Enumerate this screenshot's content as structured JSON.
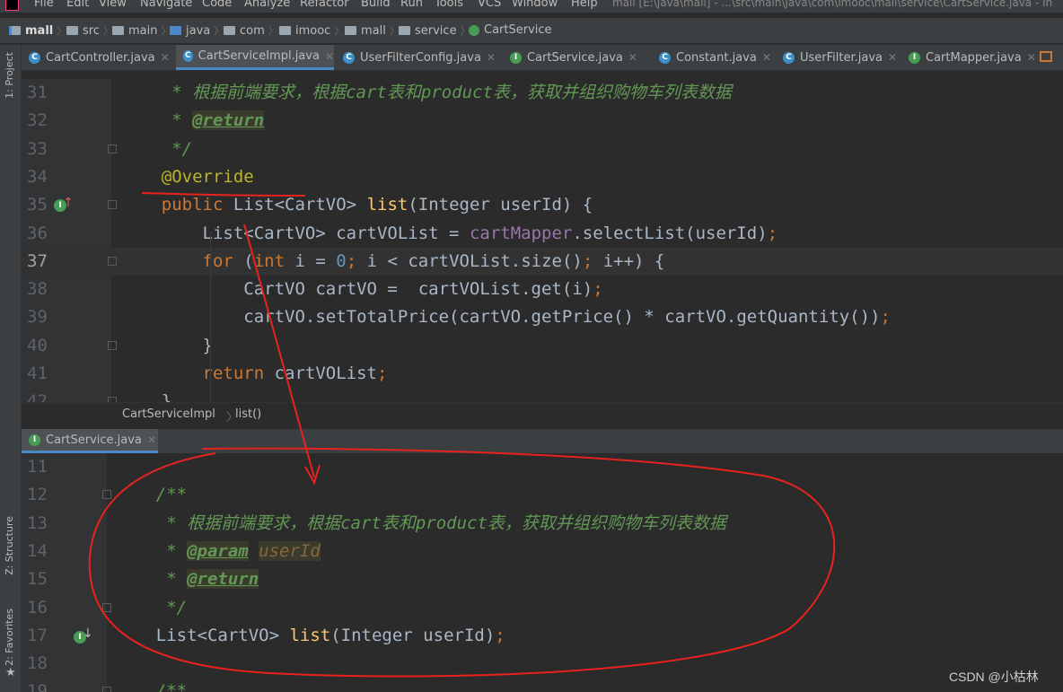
{
  "menu": {
    "items": [
      "File",
      "Edit",
      "View",
      "Navigate",
      "Code",
      "Analyze",
      "Refactor",
      "Build",
      "Run",
      "Tools",
      "VCS",
      "Window",
      "Help"
    ],
    "window_title": "mall [E:\\java\\mall] - ...\\src\\main\\java\\com\\imooc\\mall\\service\\CartService.java - In"
  },
  "navbar": {
    "crumbs": [
      "mall",
      "src",
      "main",
      "java",
      "com",
      "imooc",
      "mall",
      "service",
      "CartService"
    ]
  },
  "tabs": [
    {
      "label": "CartController.java",
      "kind": "class",
      "active": false
    },
    {
      "label": "CartServiceImpl.java",
      "kind": "class",
      "active": true
    },
    {
      "label": "UserFilterConfig.java",
      "kind": "class",
      "active": false
    },
    {
      "label": "CartService.java",
      "kind": "interface",
      "active": false
    },
    {
      "label": "Constant.java",
      "kind": "class",
      "active": false
    },
    {
      "label": "UserFilter.java",
      "kind": "class",
      "active": false
    },
    {
      "label": "CartMapper.java",
      "kind": "interface",
      "active": false
    }
  ],
  "sidebar": {
    "project_label": "1: Project",
    "structure_label": "Z: Structure",
    "favorites_label": "2: Favorites"
  },
  "editor1": {
    "lines": [
      {
        "n": "31",
        "parts": [
          [
            "cm",
            "     * 根据前端要求，根据cart表和product表，获取并组织购物车列表数据"
          ]
        ]
      },
      {
        "n": "32",
        "parts": [
          [
            "cm",
            "     * "
          ],
          [
            "tag",
            "@return"
          ]
        ]
      },
      {
        "n": "33",
        "parts": [
          [
            "cm",
            "     */"
          ]
        ]
      },
      {
        "n": "34",
        "parts": [
          [
            "an",
            "    @Override"
          ]
        ]
      },
      {
        "n": "35",
        "parts": [
          [
            "kw",
            "    public "
          ],
          [
            "",
            "List<CartVO> "
          ],
          [
            "mth",
            "list"
          ],
          [
            "",
            "(Integer userId) {"
          ]
        ]
      },
      {
        "n": "36",
        "parts": [
          [
            "",
            "        List<CartVO> cartVOList = "
          ],
          [
            "fld",
            "cartMapper"
          ],
          [
            "",
            ".selectList(userId)"
          ],
          [
            "kw",
            ";"
          ]
        ]
      },
      {
        "n": "37",
        "parts": [
          [
            "",
            "        "
          ],
          [
            "kw",
            "for"
          ],
          [
            "",
            " ("
          ],
          [
            "kw",
            "int "
          ],
          [
            "",
            "i = "
          ],
          [
            "num",
            "0"
          ],
          [
            "kw",
            "; "
          ],
          [
            "",
            "i < cartVOList.size()"
          ],
          [
            "kw",
            "; "
          ],
          [
            "",
            "i++) {"
          ]
        ],
        "current": true
      },
      {
        "n": "38",
        "parts": [
          [
            "",
            "            CartVO cartVO =  cartVOList.get(i)"
          ],
          [
            "kw",
            ";"
          ]
        ]
      },
      {
        "n": "39",
        "parts": [
          [
            "",
            "            cartVO.setTotalPrice(cartVO.getPrice() * cartVO.getQuantity())"
          ],
          [
            "kw",
            ";"
          ]
        ]
      },
      {
        "n": "40",
        "parts": [
          [
            "",
            "        }"
          ]
        ]
      },
      {
        "n": "41",
        "parts": [
          [
            "kw",
            "        return "
          ],
          [
            "",
            "cartVOList"
          ],
          [
            "kw",
            ";"
          ]
        ]
      },
      {
        "n": "42",
        "parts": [
          [
            "",
            "    }"
          ]
        ]
      }
    ]
  },
  "breadcrumb2": {
    "class_name": "CartServiceImpl",
    "method_name": "list()"
  },
  "tab2": {
    "label": "CartService.java"
  },
  "editor2": {
    "lines": [
      {
        "n": "11",
        "parts": [
          [
            "",
            ""
          ]
        ]
      },
      {
        "n": "12",
        "parts": [
          [
            "cm",
            "    /**"
          ]
        ]
      },
      {
        "n": "13",
        "parts": [
          [
            "cm",
            "     * 根据前端要求，根据cart表和product表，获取并组织购物车列表数据"
          ]
        ]
      },
      {
        "n": "14",
        "parts": [
          [
            "cm",
            "     * "
          ],
          [
            "tag",
            "@param"
          ],
          [
            "cm",
            " "
          ],
          [
            "pv",
            "userId"
          ]
        ]
      },
      {
        "n": "15",
        "parts": [
          [
            "cm",
            "     * "
          ],
          [
            "tag",
            "@return"
          ]
        ]
      },
      {
        "n": "16",
        "parts": [
          [
            "cm",
            "     */"
          ]
        ]
      },
      {
        "n": "17",
        "parts": [
          [
            "",
            "    List<CartVO> "
          ],
          [
            "mth",
            "list"
          ],
          [
            "",
            "(Integer userId)"
          ],
          [
            "kw",
            ";"
          ]
        ]
      },
      {
        "n": "18",
        "parts": [
          [
            "",
            ""
          ]
        ]
      },
      {
        "n": "19",
        "parts": [
          [
            "cm",
            "    /**"
          ]
        ]
      }
    ]
  },
  "watermark": "CSDN @小枯林"
}
